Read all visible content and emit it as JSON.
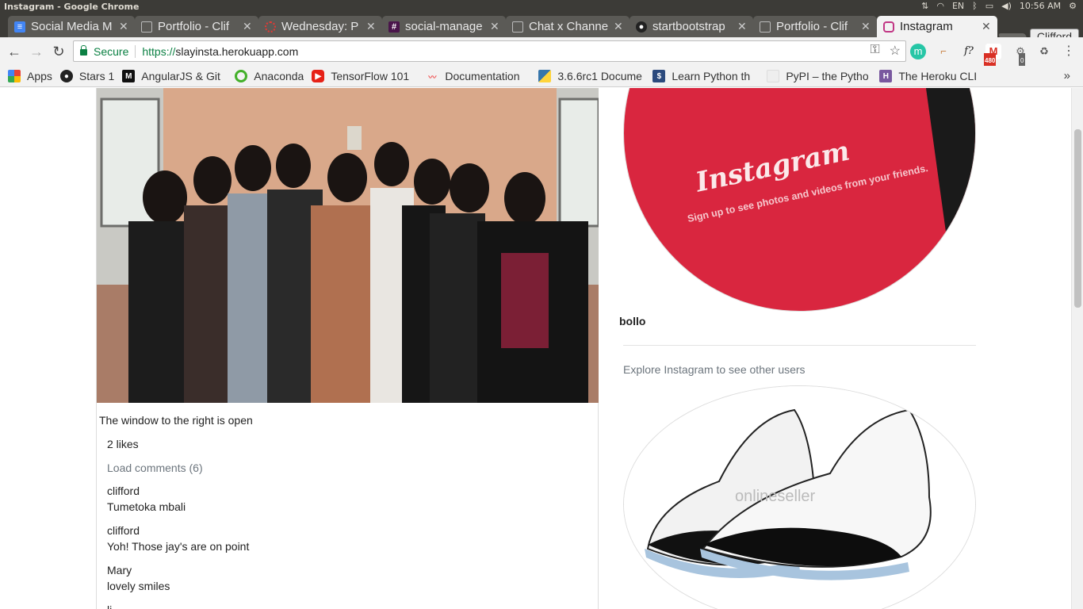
{
  "os": {
    "window_title": "Instagram - Google Chrome",
    "lang": "EN",
    "time": "10:56 AM"
  },
  "tabs": [
    {
      "label": "Social Media M",
      "icon": "docs-icon",
      "color": "#4285f4"
    },
    {
      "label": "Portfolio - Clif",
      "icon": "page-icon",
      "color": "#9e9e9e"
    },
    {
      "label": "Wednesday: P",
      "icon": "loading-icon",
      "color": "#e53935"
    },
    {
      "label": "social-manage",
      "icon": "slack-icon",
      "color": "#4a154b"
    },
    {
      "label": "Chat x Channe",
      "icon": "page-icon",
      "color": "#9e9e9e"
    },
    {
      "label": "startbootstrap",
      "icon": "github-icon",
      "color": "#222222"
    },
    {
      "label": "Portfolio - Clif",
      "icon": "page-icon",
      "color": "#9e9e9e"
    },
    {
      "label": "Instagram",
      "icon": "instagram-icon",
      "color": "#c13584"
    }
  ],
  "profile_name": "Clifford",
  "toolbar": {
    "secure_label": "Secure",
    "url_scheme": "https://",
    "url_host": "slayinsta.herokuapp.com",
    "gmail_count": "480",
    "ext_badge": "0"
  },
  "bookmarks": [
    {
      "label": "Apps",
      "icon": "apps-grid-icon",
      "color": "#e53935"
    },
    {
      "label": "Stars 1",
      "icon": "github-icon",
      "color": "#222222"
    },
    {
      "label": "AngularJS & Git",
      "icon": "medium-icon",
      "color": "#111111"
    },
    {
      "label": "Anaconda",
      "icon": "anaconda-icon",
      "color": "#43b02a"
    },
    {
      "label": "TensorFlow 101",
      "icon": "youtube-icon",
      "color": "#e62117"
    },
    {
      "label": "Documentation",
      "icon": "documentation-icon",
      "color": "#f05454"
    },
    {
      "label": "3.6.6rc1 Docume",
      "icon": "python-icon",
      "color": "#3776ab"
    },
    {
      "label": "Learn Python th",
      "icon": "book-icon",
      "color": "#2c4a7d"
    },
    {
      "label": "PyPI – the Pytho",
      "icon": "pypi-icon",
      "color": "#e0e0e0"
    },
    {
      "label": "The Heroku CLI",
      "icon": "heroku-icon",
      "color": "#79589f"
    }
  ],
  "post": {
    "caption": "The window to the right is open",
    "likes": "2 likes",
    "load_comments": "Load comments (6)",
    "comments": [
      {
        "user": "clifford",
        "text": "Tumetoka mbali"
      },
      {
        "user": "clifford",
        "text": "Yoh! Those jay's are on point"
      },
      {
        "user": "Mary",
        "text": "lovely smiles"
      },
      {
        "user": "li",
        "text": ""
      }
    ]
  },
  "sidebar": {
    "profile_image_text": "Instagram",
    "profile_image_subtext": "Sign up to see photos and videos from your friends.",
    "username": "bollo",
    "explore_text": "Explore Instagram to see other users",
    "sneaker_watermark": "onlineseller"
  }
}
